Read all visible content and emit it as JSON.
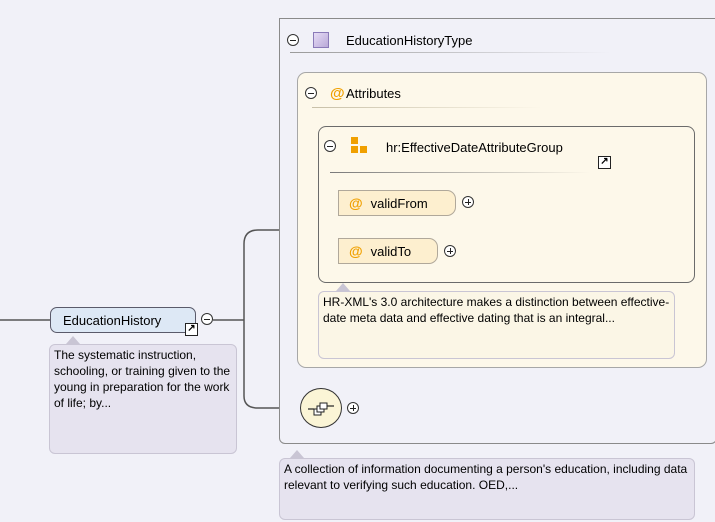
{
  "root_element": {
    "label": "EducationHistory",
    "doc": "The systematic instruction, schooling, or training given to the young in preparation for the work of life; by..."
  },
  "type_box": {
    "label": "EducationHistoryType",
    "doc": "A collection of information documenting a person's education, including data relevant to verifying such education. OED,..."
  },
  "attributes": {
    "label": "Attributes",
    "attribute_symbol": "@"
  },
  "attribute_group": {
    "label": "hr:EffectiveDateAttributeGroup",
    "doc": "HR-XML's 3.0 architecture makes a distinction between effective-date meta data and effective dating that is an integral...",
    "items": [
      {
        "symbol": "@",
        "label": "validFrom"
      },
      {
        "symbol": "@",
        "label": "validTo"
      }
    ]
  },
  "icons": {
    "type_icon": "complex-type-icon",
    "group_icon": "attribute-group-icon",
    "sequence_icon": "sequence-compositor-icon",
    "link_icon": "link-arrow-icon",
    "collapse_icon": "collapse-icon",
    "expand_icon": "expand-icon"
  },
  "colors": {
    "background": "#f1f1f8",
    "element_fill": "#dde8f5",
    "attribute_fill": "#fdefcf",
    "attribute_box_fill": "#fdf8ea",
    "attribute_symbol": "#f0a000",
    "type_icon": "#b9a9d8"
  }
}
